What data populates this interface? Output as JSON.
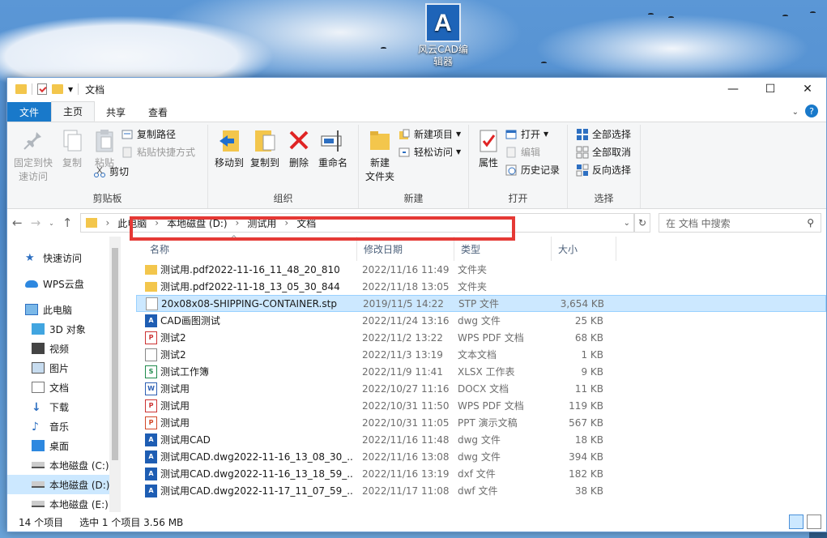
{
  "desktop": {
    "icon_label_line1": "风云CAD编",
    "icon_label_line2": "辑器",
    "icon_letter": "A"
  },
  "window": {
    "title": "文档",
    "minimize": "—",
    "maximize": "☐",
    "close": "✕"
  },
  "tabs": {
    "file": "文件",
    "home": "主页",
    "share": "共享",
    "view": "查看",
    "help": "?"
  },
  "ribbon": {
    "pin": "固定到快",
    "pin2": "速访问",
    "copy": "复制",
    "paste": "粘贴",
    "copy_path": "复制路径",
    "paste_shortcut": "粘贴快捷方式",
    "cut": "剪切",
    "clipboard": "剪贴板",
    "move_to": "移动到",
    "copy_to": "复制到",
    "delete": "删除",
    "rename": "重命名",
    "organize": "组织",
    "new_folder": "新建",
    "new_folder2": "文件夹",
    "new_item": "新建项目",
    "easy_access": "轻松访问",
    "new": "新建",
    "properties": "属性",
    "open": "打开",
    "edit": "编辑",
    "history": "历史记录",
    "open_group": "打开",
    "select_all": "全部选择",
    "select_none": "全部取消",
    "invert": "反向选择",
    "select": "选择"
  },
  "address": {
    "back": "←",
    "forward": "→",
    "up": "↑",
    "path": [
      "此电脑",
      "本地磁盘 (D:)",
      "测试用",
      "文档"
    ],
    "search_placeholder": "在 文档 中搜索"
  },
  "nav": {
    "quick": "快速访问",
    "wps": "WPS云盘",
    "pc": "此电脑",
    "obj3d": "3D 对象",
    "video": "视频",
    "pics": "图片",
    "docs": "文档",
    "downloads": "下载",
    "music": "音乐",
    "desktop": "桌面",
    "c": "本地磁盘 (C:)",
    "d": "本地磁盘 (D:)",
    "e": "本地磁盘 (E:)"
  },
  "columns": {
    "name": "名称",
    "date": "修改日期",
    "type": "类型",
    "size": "大小"
  },
  "files": [
    {
      "name": "测试用.pdf2022-11-16_11_48_20_810",
      "date": "2022/11/16 11:49",
      "type": "文件夹",
      "size": "",
      "icon": "folder"
    },
    {
      "name": "测试用.pdf2022-11-18_13_05_30_844",
      "date": "2022/11/18 13:05",
      "type": "文件夹",
      "size": "",
      "icon": "folder"
    },
    {
      "name": "20x08x08-SHIPPING-CONTAINER.stp",
      "date": "2019/11/5 14:22",
      "type": "STP 文件",
      "size": "3,654 KB",
      "icon": "doc"
    },
    {
      "name": "CAD画图测试",
      "date": "2022/11/24 13:16",
      "type": "dwg 文件",
      "size": "25 KB",
      "icon": "cad"
    },
    {
      "name": "测试2",
      "date": "2022/11/2 13:22",
      "type": "WPS PDF 文档",
      "size": "68 KB",
      "icon": "pdf"
    },
    {
      "name": "测试2",
      "date": "2022/11/3 13:19",
      "type": "文本文档",
      "size": "1 KB",
      "icon": "txt"
    },
    {
      "name": "测试工作簿",
      "date": "2022/11/9 11:41",
      "type": "XLSX 工作表",
      "size": "9 KB",
      "icon": "xls"
    },
    {
      "name": "测试用",
      "date": "2022/10/27 11:16",
      "type": "DOCX 文档",
      "size": "11 KB",
      "icon": "docx"
    },
    {
      "name": "测试用",
      "date": "2022/10/31 11:50",
      "type": "WPS PDF 文档",
      "size": "119 KB",
      "icon": "pdf"
    },
    {
      "name": "测试用",
      "date": "2022/10/31 11:05",
      "type": "PPT 演示文稿",
      "size": "567 KB",
      "icon": "ppt"
    },
    {
      "name": "测试用CAD",
      "date": "2022/11/16 11:48",
      "type": "dwg 文件",
      "size": "18 KB",
      "icon": "cad"
    },
    {
      "name": "测试用CAD.dwg2022-11-16_13_08_30_...",
      "date": "2022/11/16 13:08",
      "type": "dwg 文件",
      "size": "394 KB",
      "icon": "cad"
    },
    {
      "name": "测试用CAD.dwg2022-11-16_13_18_59_...",
      "date": "2022/11/16 13:19",
      "type": "dxf 文件",
      "size": "182 KB",
      "icon": "cad"
    },
    {
      "name": "测试用CAD.dwg2022-11-17_11_07_59_...",
      "date": "2022/11/17 11:08",
      "type": "dwf 文件",
      "size": "38 KB",
      "icon": "cad"
    }
  ],
  "status": {
    "count": "14 个项目",
    "selected": "选中 1 个项目  3.56 MB"
  }
}
